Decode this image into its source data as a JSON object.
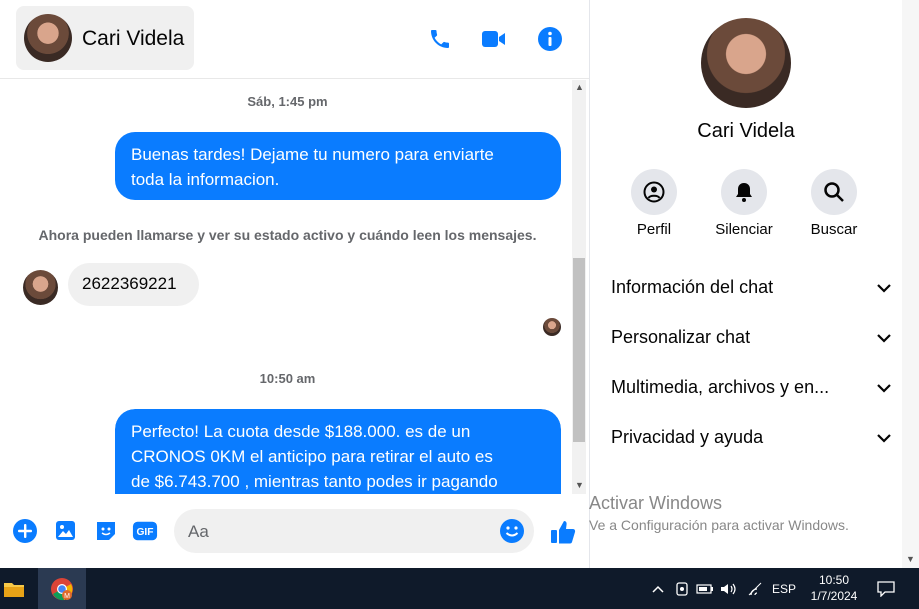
{
  "header": {
    "contact_name": "Cari Videla"
  },
  "icons": {
    "phone": "phone-icon",
    "video": "video-icon",
    "info": "info-icon"
  },
  "conversation": {
    "timestamp_1": "Sáb, 1:45 pm",
    "out_message_1_line1": "Buenas tardes! Dejame tu numero para enviarte",
    "out_message_1_line2": "toda la informacion.",
    "system_notice": "Ahora pueden llamarse y ver su estado activo y cuándo leen los mensajes.",
    "in_message_1": "2622369221",
    "timestamp_2": "10:50 am",
    "out_message_2_line1": "Perfecto! La cuota desde $188.000. es de un",
    "out_message_2_line2": "CRONOS 0KM el anticipo para retirar el auto es",
    "out_message_2_line3": "de $6.743.700 , mientras tanto podes ir pagando"
  },
  "composer": {
    "placeholder": "Aa"
  },
  "right_panel": {
    "name": "Cari Videla",
    "actions": [
      {
        "label": "Perfil"
      },
      {
        "label": "Silenciar"
      },
      {
        "label": "Buscar"
      }
    ],
    "sections": [
      {
        "label": "Información del chat"
      },
      {
        "label": "Personalizar chat"
      },
      {
        "label": "Multimedia, archivos y en..."
      },
      {
        "label": "Privacidad y ayuda"
      }
    ]
  },
  "watermark": {
    "line1": "Activar Windows",
    "line2": "Ve a Configuración para activar Windows."
  },
  "taskbar": {
    "language": "ESP",
    "time": "10:50",
    "date": "1/7/2024"
  },
  "colors": {
    "accent": "#0a7cff",
    "bubble_in": "#f0f0f0",
    "taskbar": "#0f1a2a"
  }
}
